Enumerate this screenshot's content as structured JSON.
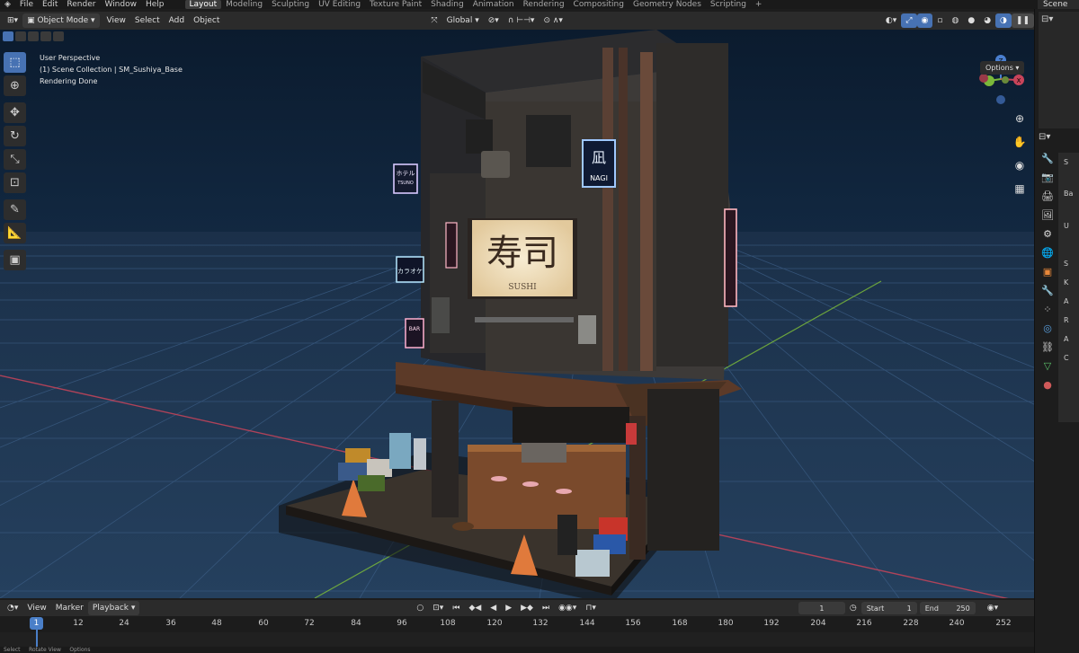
{
  "menu": {
    "items": [
      "File",
      "Edit",
      "Render",
      "Window",
      "Help"
    ],
    "workspaces": [
      "Layout",
      "Modeling",
      "Sculpting",
      "UV Editing",
      "Texture Paint",
      "Shading",
      "Animation",
      "Rendering",
      "Compositing",
      "Geometry Nodes",
      "Scripting"
    ],
    "add_tab": "+",
    "active_workspace": "Layout",
    "scene": "Scene"
  },
  "viewport_header": {
    "mode": "Object Mode",
    "menus": [
      "View",
      "Select",
      "Add",
      "Object"
    ],
    "orientation": "Global",
    "options": "Options"
  },
  "viewport": {
    "perspective": "User Perspective",
    "collection": "(1) Scene Collection | SM_Sushiya_Base",
    "status": "Rendering Done",
    "gizmo_axes": [
      "X",
      "Y",
      "Z"
    ]
  },
  "signage": {
    "main_kanji": "寿司",
    "main_roman": "SUSHI",
    "hotel_kanji": "ホテル",
    "hotel_roman": "TSUNO",
    "nagi_kanji": "凪",
    "nagi_roman": "NAGI",
    "karaoke": "カラオケ",
    "bar": "BAR"
  },
  "timeline": {
    "menus": [
      "View",
      "Marker",
      "Playback"
    ],
    "current_frame": "1",
    "start_label": "Start",
    "start_value": "1",
    "end_label": "End",
    "end_value": "250",
    "ruler": [
      "1",
      "12",
      "24",
      "36",
      "48",
      "60",
      "72",
      "84",
      "96",
      "108",
      "120",
      "132",
      "144",
      "156",
      "168",
      "180",
      "192",
      "204",
      "216",
      "228",
      "240",
      "252"
    ]
  },
  "statusbar": {
    "hints": [
      "Select",
      "Rotate View",
      "Options"
    ]
  },
  "properties": {
    "rows": [
      "S",
      "Ba",
      "U",
      "",
      "S",
      "K",
      "A",
      "R",
      "A",
      "C"
    ]
  },
  "colors": {
    "accent": "#4772b3",
    "grid": "#3c5e86",
    "x_axis": "#c8445a",
    "y_axis": "#7ab83a"
  }
}
